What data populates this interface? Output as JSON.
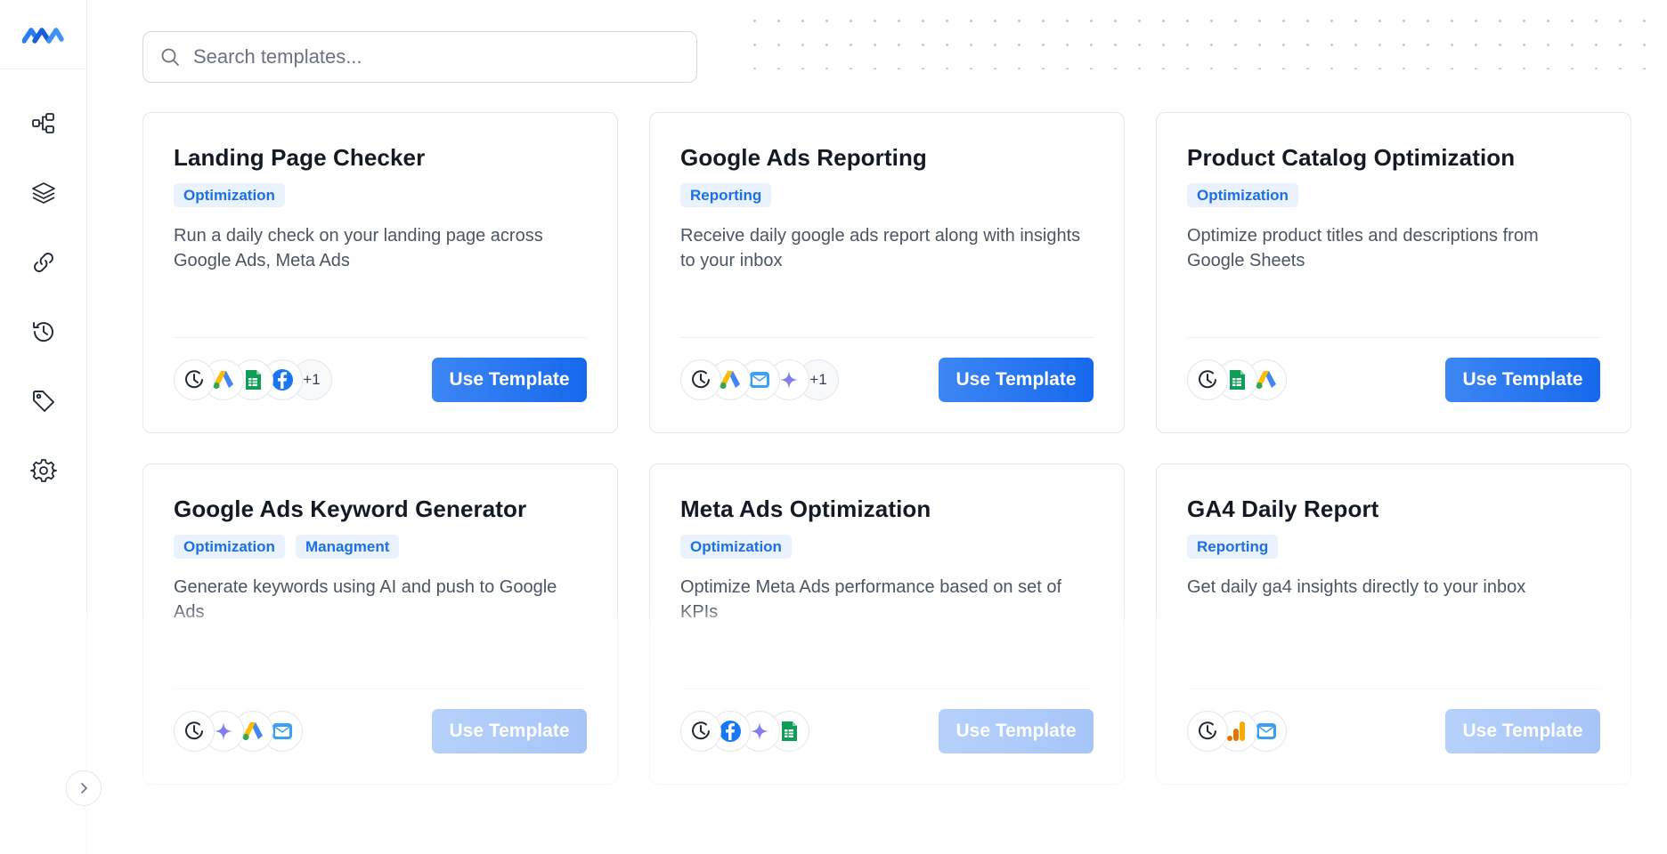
{
  "app": {
    "accent_color": "#1668ed",
    "tag_bg_color": "#eaf2fe",
    "tag_text_color": "#1d6fe5"
  },
  "sidebar": {
    "logo_icon": "brand-logo-icon",
    "items": [
      {
        "name": "workflows",
        "icon": "flow-icon"
      },
      {
        "name": "templates",
        "icon": "layers-icon"
      },
      {
        "name": "connections",
        "icon": "link-icon"
      },
      {
        "name": "history",
        "icon": "history-icon"
      },
      {
        "name": "tags",
        "icon": "tag-icon"
      },
      {
        "name": "settings",
        "icon": "gear-icon"
      }
    ],
    "collapse_icon": "chevron-right-icon"
  },
  "search": {
    "placeholder": "Search templates...",
    "value": ""
  },
  "templates": [
    {
      "title": "Landing Page Checker",
      "tags": [
        "Optimization"
      ],
      "description": "Run a daily check on your landing page across Google Ads, Meta Ads",
      "integrations": [
        "schedule-icon",
        "google-ads-icon",
        "google-sheets-icon",
        "facebook-icon"
      ],
      "more": "+1",
      "button_label": "Use Template"
    },
    {
      "title": "Google Ads Reporting",
      "tags": [
        "Reporting"
      ],
      "description": "Receive daily google ads report along with insights to your inbox",
      "integrations": [
        "schedule-icon",
        "google-ads-icon",
        "email-icon",
        "ai-sparkle-icon"
      ],
      "more": "+1",
      "button_label": "Use Template"
    },
    {
      "title": "Product Catalog Optimization",
      "tags": [
        "Optimization"
      ],
      "description": "Optimize product titles and descriptions from Google Sheets",
      "integrations": [
        "schedule-icon",
        "google-sheets-icon",
        "google-ads-icon"
      ],
      "more": "",
      "button_label": "Use Template"
    },
    {
      "title": "Google Ads Keyword Generator",
      "tags": [
        "Optimization",
        "Managment"
      ],
      "description": "Generate keywords using AI and push to Google Ads",
      "integrations": [
        "schedule-icon",
        "ai-sparkle-icon",
        "google-ads-icon",
        "email-icon"
      ],
      "more": "",
      "button_label": "Use Template"
    },
    {
      "title": "Meta Ads Optimization",
      "tags": [
        "Optimization"
      ],
      "description": "Optimize Meta Ads performance based on set of KPIs",
      "integrations": [
        "schedule-icon",
        "facebook-icon",
        "ai-sparkle-icon",
        "google-sheets-icon"
      ],
      "more": "",
      "button_label": "Use Template"
    },
    {
      "title": "GA4 Daily Report",
      "tags": [
        "Reporting"
      ],
      "description": "Get daily ga4 insights directly to your inbox",
      "integrations": [
        "schedule-icon",
        "google-analytics-icon",
        "email-icon"
      ],
      "more": "",
      "button_label": "Use Template"
    }
  ]
}
